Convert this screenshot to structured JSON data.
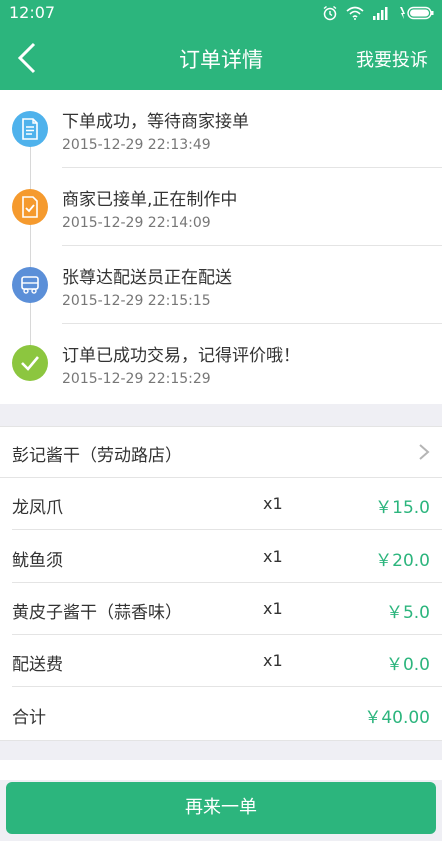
{
  "status_bar": {
    "time": "12:07"
  },
  "header": {
    "title": "订单详情",
    "complain_label": "我要投诉",
    "back_icon": "chevron-left-icon"
  },
  "timeline": [
    {
      "title": "下单成功，等待商家接单",
      "time": "2015-12-29 22:13:49",
      "icon": "document-icon",
      "color": "#4fb2ec"
    },
    {
      "title": "商家已接单,正在制作中",
      "time": "2015-12-29 22:14:09",
      "icon": "clipboard-check-icon",
      "color": "#f59a2e"
    },
    {
      "title": "张尊达配送员正在配送",
      "time": "2015-12-29 22:15:15",
      "icon": "truck-icon",
      "color": "#5b8fd8"
    },
    {
      "title": "订单已成功交易，记得评价哦！",
      "time": "2015-12-29 22:15:29",
      "icon": "checkmark-icon",
      "color": "#8cc63f"
    }
  ],
  "order": {
    "shop_name": "彭记酱干（劳动路店）",
    "items": [
      {
        "name": "龙凤爪",
        "qty": "x1",
        "price": "￥15.0"
      },
      {
        "name": "鱿鱼须",
        "qty": "x1",
        "price": "￥20.0"
      },
      {
        "name": "黄皮子酱干（蒜香味）",
        "qty": "x1",
        "price": "￥5.0"
      },
      {
        "name": "配送费",
        "qty": "x1",
        "price": "￥0.0"
      }
    ],
    "total_label": "合计",
    "total_value": "￥40.00"
  },
  "footer": {
    "reorder_label": "再来一单"
  },
  "colors": {
    "accent": "#2cb57d",
    "background": "#efeff4"
  }
}
